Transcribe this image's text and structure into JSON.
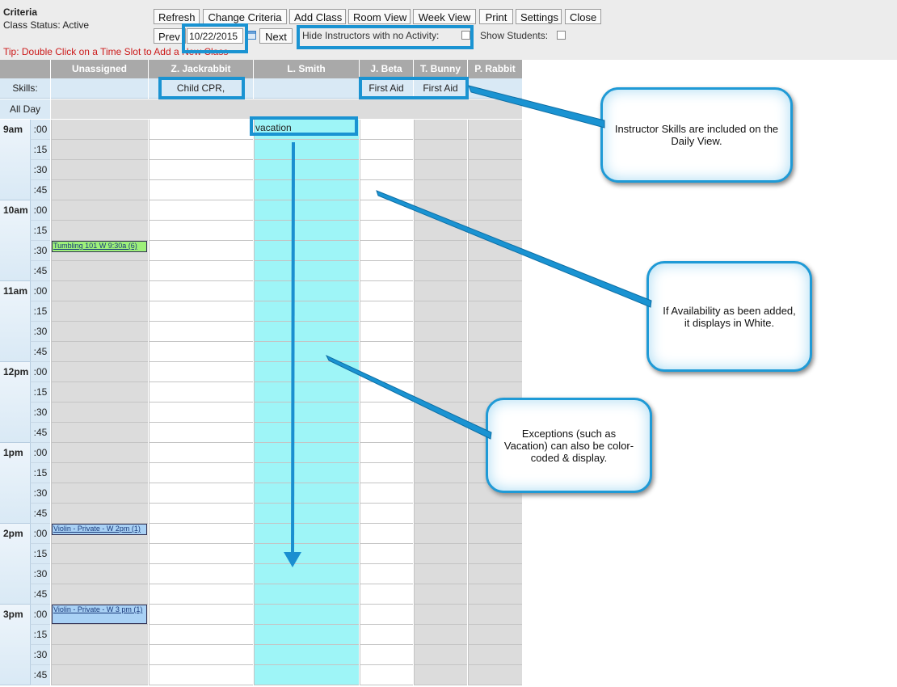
{
  "criteria": {
    "title": "Criteria",
    "status": "Class Status: Active"
  },
  "toolbar": {
    "refresh": "Refresh",
    "change_criteria": "Change Criteria",
    "add_class": "Add Class",
    "room_view": "Room View",
    "week_view": "Week View",
    "print": "Print",
    "settings": "Settings",
    "close": "Close",
    "prev": "Prev",
    "date_value": "10/22/2015",
    "next": "Next",
    "hide_instructors_label": "Hide Instructors with no Activity:",
    "show_students_label": "Show Students:"
  },
  "tip": "Tip: Double Click on a Time Slot to Add a New Class",
  "columns": [
    "Unassigned",
    "Z. Jackrabbit",
    "L. Smith",
    "J. Beta",
    "T. Bunny",
    "P. Rabbit"
  ],
  "skills_label": "Skills:",
  "skills": [
    "",
    "Child CPR,",
    "",
    "First Aid",
    "First Aid",
    ""
  ],
  "all_day_label": "All Day",
  "hours": [
    "9am",
    "10am",
    "11am",
    "12pm",
    "1pm",
    "2pm",
    "3pm"
  ],
  "minutes": [
    ":00",
    ":15",
    ":30",
    ":45"
  ],
  "exception": {
    "label": "vacation",
    "color": "#9ef5f7"
  },
  "events": [
    {
      "label": "Tumbling 101 W 9:30a (6)",
      "color": "#9ef07a"
    },
    {
      "label": "Violin - Private - W 2pm (1)",
      "color": "#a9d1f5"
    },
    {
      "label": "Violin - Private - W 3 pm (1)",
      "color": "#a9d1f5"
    }
  ],
  "colors": {
    "available": "#ffffff",
    "unavailable": "#dcdcdc",
    "time_column": "#d9e9f5",
    "highlight": "#1a93d2"
  },
  "callouts": {
    "skills": "Instructor Skills are included on the Daily View.",
    "availability": "If Availability as been added, it displays in White.",
    "exceptions": "Exceptions (such as Vacation) can also be color-coded & display."
  }
}
